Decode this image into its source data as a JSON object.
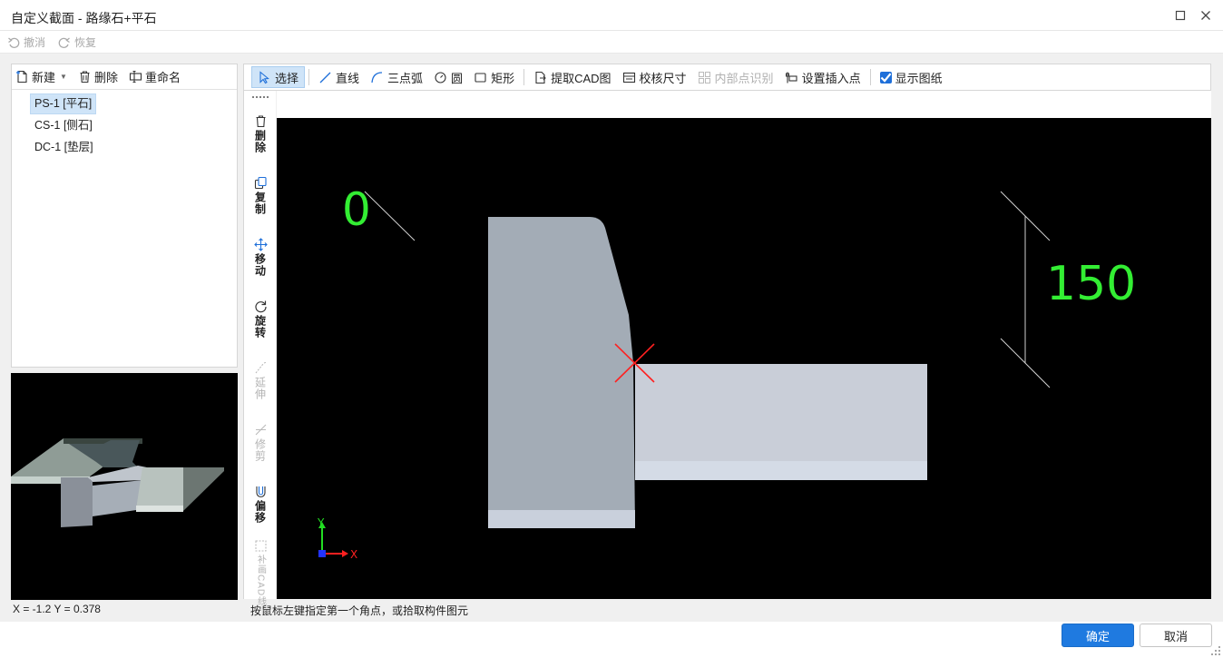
{
  "window": {
    "title": "自定义截面 - 路缘石+平石"
  },
  "undo": {
    "undo_label": "撤消",
    "redo_label": "恢复"
  },
  "left_toolbar": {
    "new_label": "新建",
    "delete_label": "删除",
    "rename_label": "重命名"
  },
  "tree": {
    "items": [
      {
        "label": "PS-1 [平石]",
        "selected": true
      },
      {
        "label": "CS-1 [侧石]",
        "selected": false
      },
      {
        "label": "DC-1 [垫层]",
        "selected": false
      }
    ]
  },
  "coords": "X = -1.2 Y = 0.378",
  "edit_toolbar": {
    "select": "选择",
    "line": "直线",
    "arc": "三点弧",
    "circle": "圆",
    "rect": "矩形",
    "extract_cad": "提取CAD图",
    "check_dim": "校核尺寸",
    "inner_point": "内部点识别",
    "insert_point": "设置插入点",
    "show_drawing": "显示图纸",
    "show_drawing_checked": true
  },
  "side_toolbar": {
    "delete": "删除",
    "copy": "复制",
    "move": "移动",
    "rotate": "旋转",
    "extend": "延伸",
    "trim": "修剪",
    "offset": "偏移",
    "cad_line": "补画CAD线"
  },
  "canvas": {
    "dim_left": "0",
    "dim_right": "150",
    "axis_y": "Y",
    "axis_x": "X",
    "colors": {
      "dimension": "#33ee33",
      "section": "#a3acb6",
      "section_light": "#c9ced8",
      "marker": "#ff2020"
    }
  },
  "status": "按鼠标左键指定第一个角点，或拾取构件图元",
  "footer": {
    "ok_label": "确定",
    "cancel_label": "取消"
  }
}
